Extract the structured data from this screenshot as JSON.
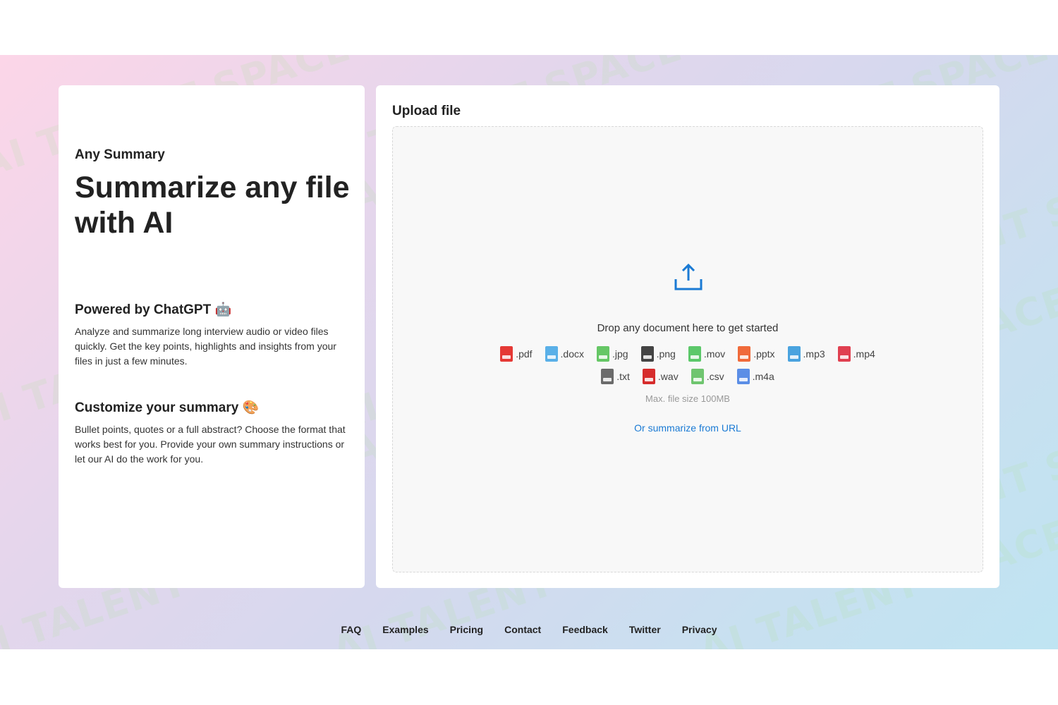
{
  "brand": "Any Summary",
  "headline": "Summarize any file with AI",
  "features": [
    {
      "title": "Powered by ChatGPT 🤖",
      "description": "Analyze and summarize long interview audio or video files quickly. Get the key points, highlights and insights from your files in just a few minutes."
    },
    {
      "title": "Customize your summary 🎨",
      "description": "Bullet points, quotes or a full abstract? Choose the format that works best for you. Provide your own summary instructions or let our AI do the work for you."
    }
  ],
  "upload": {
    "title": "Upload file",
    "drop_text": "Drop any document here to get started",
    "max_size": "Max. file size 100MB",
    "url_link": "Or summarize from URL",
    "types_row1": [
      {
        "label": ".pdf",
        "color": "#e53935"
      },
      {
        "label": ".docx",
        "color": "#5ab0e8"
      },
      {
        "label": ".jpg",
        "color": "#66c766"
      },
      {
        "label": ".png",
        "color": "#444444"
      },
      {
        "label": ".mov",
        "color": "#5cc86a"
      },
      {
        "label": ".pptx",
        "color": "#f06a3a"
      },
      {
        "label": ".mp3",
        "color": "#4aa3df"
      },
      {
        "label": ".mp4",
        "color": "#e04050"
      }
    ],
    "types_row2": [
      {
        "label": ".txt",
        "color": "#6b6b6b"
      },
      {
        "label": ".wav",
        "color": "#d62c2c"
      },
      {
        "label": ".csv",
        "color": "#6fc56f"
      },
      {
        "label": ".m4a",
        "color": "#5b8ee6"
      }
    ]
  },
  "watermark": "AI TALENT SPACE",
  "footer_links": [
    "FAQ",
    "Examples",
    "Pricing",
    "Contact",
    "Feedback",
    "Twitter",
    "Privacy"
  ],
  "colors": {
    "link": "#1a7ad4",
    "upload_icon": "#1a7ad4"
  }
}
